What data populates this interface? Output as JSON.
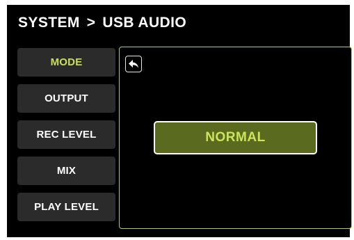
{
  "header": {
    "section": "SYSTEM",
    "separator": ">",
    "page": "USB AUDIO"
  },
  "sidebar": {
    "items": [
      {
        "label": "MODE",
        "active": true
      },
      {
        "label": "OUTPUT",
        "active": false
      },
      {
        "label": "REC LEVEL",
        "active": false
      },
      {
        "label": "MIX",
        "active": false
      },
      {
        "label": "PLAY LEVEL",
        "active": false
      }
    ]
  },
  "panel": {
    "back_icon": "back-arrow-icon",
    "value_label": "NORMAL"
  },
  "colors": {
    "accent": "#c9e05a",
    "panel_border": "#b5cf3c",
    "selected_fill": "#5a6a1f",
    "button_bg": "#2b2b2b",
    "background": "#000000"
  }
}
